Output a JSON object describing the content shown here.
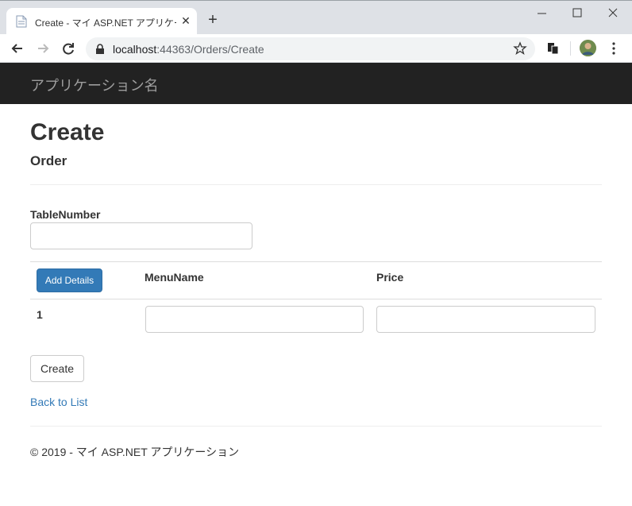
{
  "browser": {
    "tab_title": "Create - マイ ASP.NET アプリケーション",
    "url_host": "localhost",
    "url_rest": ":44363/Orders/Create"
  },
  "site": {
    "brand": "アプリケーション名"
  },
  "page": {
    "title": "Create",
    "subtitle": "Order"
  },
  "form": {
    "table_number_label": "TableNumber",
    "table_number_value": ""
  },
  "details": {
    "add_button_label": "Add Details",
    "headers": [
      "MenuName",
      "Price"
    ],
    "rows": [
      {
        "index": "1",
        "menu_name": "",
        "price": ""
      }
    ]
  },
  "actions": {
    "create_label": "Create",
    "back_link_label": "Back to List"
  },
  "footer": {
    "text": "© 2019 - マイ ASP.NET アプリケーション"
  },
  "icons": [
    "file-icon",
    "close-icon",
    "plus-icon",
    "minimize-icon",
    "maximize-icon",
    "window-close-icon",
    "back-arrow-icon",
    "forward-arrow-icon",
    "reload-icon",
    "lock-icon",
    "star-icon",
    "extension-icon",
    "avatar",
    "more-vert-icon"
  ],
  "colors": {
    "navbar_bg": "#222222",
    "brand_text": "#9d9d9d",
    "primary": "#337ab7",
    "link": "#337ab7"
  }
}
